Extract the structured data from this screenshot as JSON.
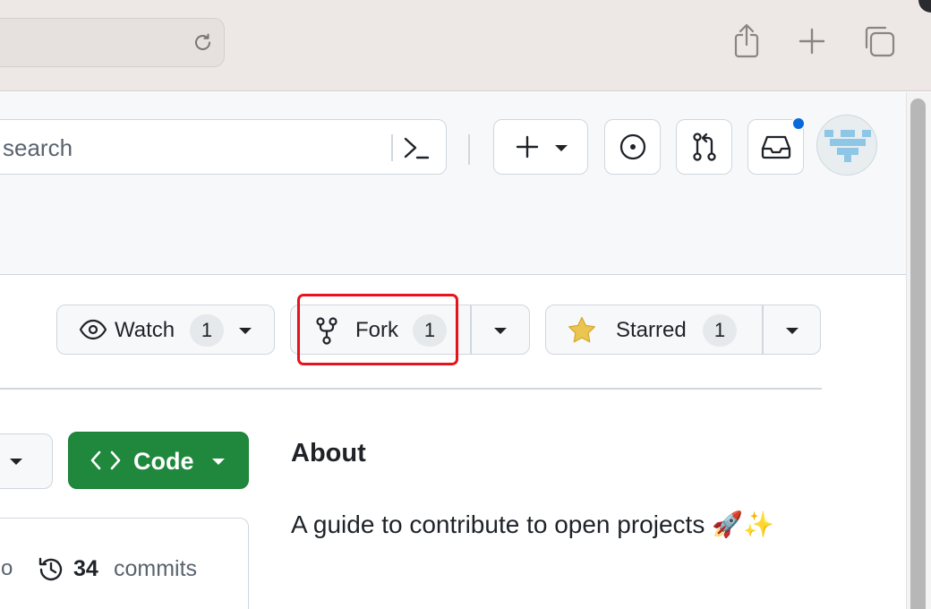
{
  "browser": {
    "reload_icon": "reload-icon",
    "share_icon": "share-icon",
    "new_tab_icon": "plus-icon",
    "tabs_icon": "tabs-overview-icon"
  },
  "header": {
    "search_placeholder": "search",
    "command_icon": "command-palette-icon",
    "create_icon": "plus-icon",
    "issues_icon": "issue-opened-icon",
    "pulls_icon": "git-pull-request-icon",
    "inbox_icon": "inbox-icon",
    "notification_color": "#0969da"
  },
  "repo_actions": {
    "watch": {
      "label": "Watch",
      "count": "1"
    },
    "fork": {
      "label": "Fork",
      "count": "1"
    },
    "starred": {
      "label": "Starred",
      "count": "1"
    },
    "highlight_color": "#e8121c"
  },
  "code_button": {
    "label": "Code",
    "color": "#1f883d"
  },
  "commits": {
    "truncated_text": "o",
    "count": "34",
    "label": "commits"
  },
  "about": {
    "title": "About",
    "description": "A guide to contribute to open projects 🚀✨"
  }
}
